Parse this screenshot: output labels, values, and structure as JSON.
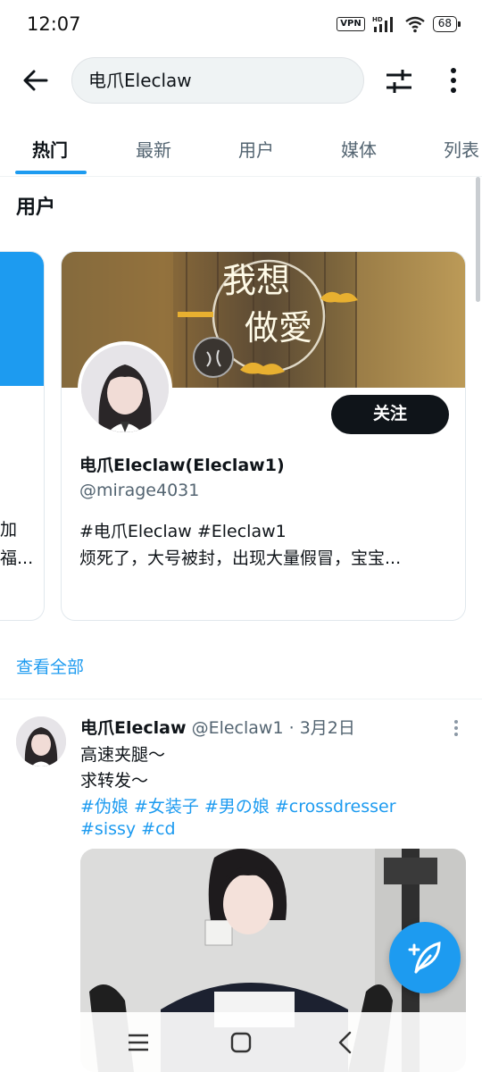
{
  "status_bar": {
    "time": "12:07",
    "vpn": "VPN",
    "hd": "HD",
    "battery": "68"
  },
  "search": {
    "query": "电爪Eleclaw"
  },
  "tabs": [
    {
      "label": "热门",
      "active": true
    },
    {
      "label": "最新"
    },
    {
      "label": "用户"
    },
    {
      "label": "媒体"
    },
    {
      "label": "列表"
    }
  ],
  "users_section": {
    "title": "用户",
    "left_card": {
      "text1": "加",
      "text2": "福..."
    },
    "card": {
      "banner_text1": "我想",
      "banner_text2": "做愛",
      "follow_label": "关注",
      "name": "电爪Eleclaw(Eleclaw1)",
      "handle": "@mirage4031",
      "bio_line1": "#电爪Eleclaw #Eleclaw1",
      "bio_line2": "烦死了，大号被封，出现大量假冒，宝宝..."
    },
    "see_all": "查看全部"
  },
  "tweet": {
    "name": "电爪Eleclaw",
    "handle": "@Eleclaw1",
    "separator": " · ",
    "date": "3月2日",
    "line1": "高速夹腿～",
    "line2": "求转发～",
    "hashtags_line1": "#伪娘 #女装子 #男の娘 #crossdresser",
    "hashtags_line2": "#sissy #cd"
  },
  "colors": {
    "accent": "#1d9bf0",
    "text_primary": "#0f1419",
    "text_secondary": "#536471",
    "follow_button": "#0f1419"
  },
  "icons": [
    "back-arrow-icon",
    "filter-icon",
    "more-vertical-icon",
    "compose-icon",
    "menu-icon",
    "home-square-icon",
    "nav-back-icon"
  ]
}
